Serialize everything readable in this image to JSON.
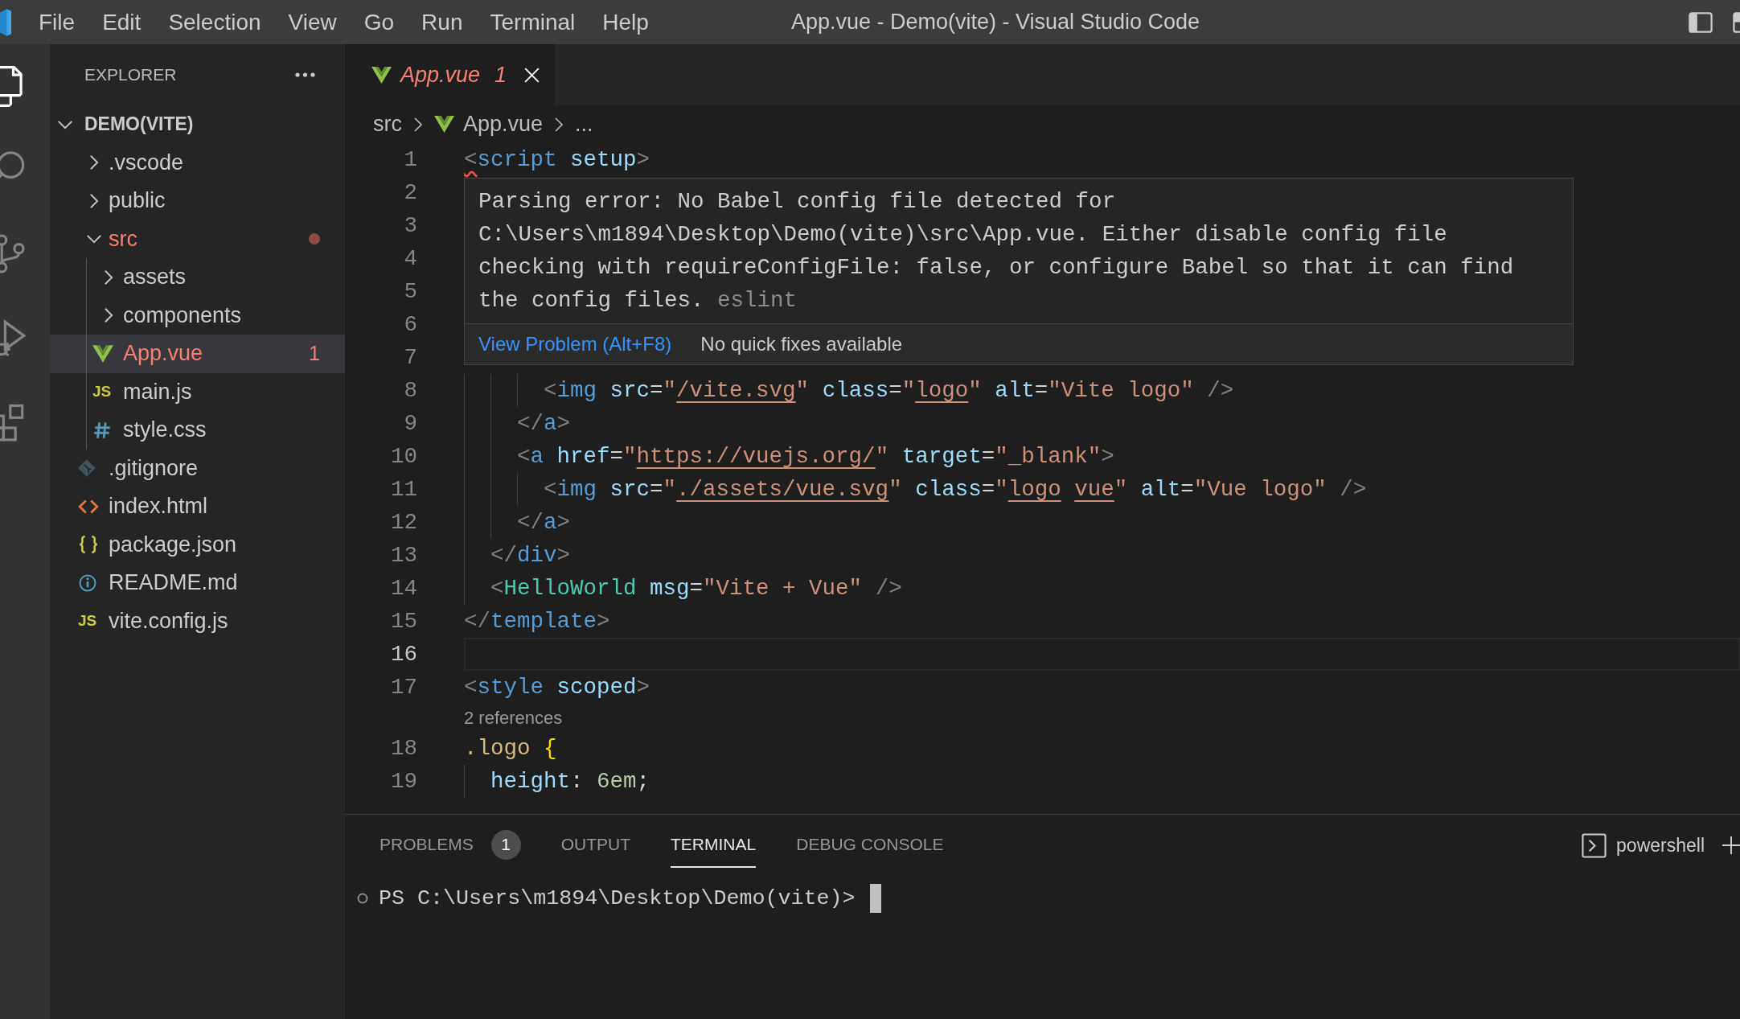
{
  "menu_bar": [
    "File",
    "Edit",
    "Selection",
    "View",
    "Go",
    "Run",
    "Terminal",
    "Help"
  ],
  "window": {
    "title": "App.vue - Demo(vite) - Visual Studio Code"
  },
  "activity_bar": [
    {
      "selected": true
    },
    {
      "selected": false
    },
    {
      "selected": false
    },
    {
      "selected": false
    },
    {
      "selected": false
    }
  ],
  "explorer": {
    "title": "EXPLORER",
    "root": {
      "label": "DEMO(VITE)",
      "expanded": true,
      "children": [
        {
          "label": ".vscode",
          "kind": "folder",
          "expanded": false,
          "selected": false,
          "error": false
        },
        {
          "label": "public",
          "kind": "folder",
          "expanded": false,
          "selected": false,
          "error": false
        },
        {
          "label": "src",
          "kind": "folder",
          "expanded": true,
          "selected": false,
          "error": true,
          "children": [
            {
              "label": "assets",
              "kind": "folder",
              "expanded": false,
              "selected": false,
              "error": false
            },
            {
              "label": "components",
              "kind": "folder",
              "expanded": false,
              "selected": false,
              "error": false
            },
            {
              "label": "App.vue",
              "kind": "vue",
              "selected": true,
              "error": true,
              "problems": "1"
            },
            {
              "label": "main.js",
              "kind": "js",
              "icon_text": "JS",
              "selected": false,
              "error": false
            },
            {
              "label": "style.css",
              "kind": "css",
              "selected": false,
              "error": false
            }
          ]
        },
        {
          "label": ".gitignore",
          "kind": "git",
          "selected": false,
          "error": false
        },
        {
          "label": "index.html",
          "kind": "html",
          "selected": false,
          "error": false
        },
        {
          "label": "package.json",
          "kind": "json",
          "selected": false,
          "error": false
        },
        {
          "label": "README.md",
          "kind": "info",
          "selected": false,
          "error": false
        },
        {
          "label": "vite.config.js",
          "kind": "js",
          "icon_text": "JS",
          "selected": false,
          "error": false
        }
      ]
    }
  },
  "editor": {
    "tabs": [
      {
        "label": "App.vue",
        "kind": "vue",
        "selected": true,
        "preview": true,
        "error": true,
        "problems": "1"
      }
    ],
    "breadcrumbs": [
      {
        "label": "src",
        "kind": "folder"
      },
      {
        "label": "App.vue",
        "kind": "vue"
      },
      {
        "label": "...",
        "kind": "symbol"
      }
    ],
    "lines": [
      {
        "kind": "code",
        "number": "1",
        "current": false,
        "tokens": [
          {
            "kind": "error",
            "text": "<"
          },
          {
            "kind": "tag",
            "text": "script"
          },
          {
            "kind": "attr",
            "text": " setup"
          },
          {
            "kind": "punct",
            "text": ">"
          }
        ]
      },
      {
        "kind": "code",
        "number": "2",
        "current": false
      },
      {
        "kind": "code",
        "number": "3",
        "current": false
      },
      {
        "kind": "code",
        "number": "4",
        "current": false
      },
      {
        "kind": "code",
        "number": "5",
        "current": false
      },
      {
        "kind": "code",
        "number": "6",
        "current": false
      },
      {
        "kind": "code",
        "number": "7",
        "current": false
      },
      {
        "kind": "code",
        "number": "8",
        "current": false,
        "tokens": [
          {
            "kind": "punct",
            "text": "      <"
          },
          {
            "kind": "tag",
            "text": "img"
          },
          {
            "kind": "attr",
            "text": " src"
          },
          {
            "kind": "op",
            "text": "="
          },
          {
            "kind": "string",
            "text": "\""
          },
          {
            "kind": "link",
            "text": "/vite.svg"
          },
          {
            "kind": "string",
            "text": "\""
          },
          {
            "kind": "attr",
            "text": " class"
          },
          {
            "kind": "op",
            "text": "="
          },
          {
            "kind": "string",
            "text": "\""
          },
          {
            "kind": "link",
            "text": "logo"
          },
          {
            "kind": "string",
            "text": "\""
          },
          {
            "kind": "attr",
            "text": " alt"
          },
          {
            "kind": "op",
            "text": "="
          },
          {
            "kind": "string",
            "text": "\"Vite logo\""
          },
          {
            "kind": "punct",
            "text": " />"
          }
        ]
      },
      {
        "kind": "code",
        "number": "9",
        "current": false,
        "tokens": [
          {
            "kind": "punct",
            "text": "    </"
          },
          {
            "kind": "tag",
            "text": "a"
          },
          {
            "kind": "punct",
            "text": ">"
          }
        ]
      },
      {
        "kind": "code",
        "number": "10",
        "current": false,
        "tokens": [
          {
            "kind": "punct",
            "text": "    <"
          },
          {
            "kind": "tag",
            "text": "a"
          },
          {
            "kind": "attr",
            "text": " href"
          },
          {
            "kind": "op",
            "text": "="
          },
          {
            "kind": "string",
            "text": "\""
          },
          {
            "kind": "link",
            "text": "https://vuejs.org/"
          },
          {
            "kind": "string",
            "text": "\""
          },
          {
            "kind": "attr",
            "text": " target"
          },
          {
            "kind": "op",
            "text": "="
          },
          {
            "kind": "string",
            "text": "\"_blank\""
          },
          {
            "kind": "punct",
            "text": ">"
          }
        ]
      },
      {
        "kind": "code",
        "number": "11",
        "current": false,
        "tokens": [
          {
            "kind": "punct",
            "text": "      <"
          },
          {
            "kind": "tag",
            "text": "img"
          },
          {
            "kind": "attr",
            "text": " src"
          },
          {
            "kind": "op",
            "text": "="
          },
          {
            "kind": "string",
            "text": "\""
          },
          {
            "kind": "link",
            "text": "./assets/vue.svg"
          },
          {
            "kind": "string",
            "text": "\""
          },
          {
            "kind": "attr",
            "text": " class"
          },
          {
            "kind": "op",
            "text": "="
          },
          {
            "kind": "string",
            "text": "\""
          },
          {
            "kind": "link",
            "text": "logo"
          },
          {
            "kind": "link",
            "text": " vue"
          },
          {
            "kind": "string",
            "text": "\""
          },
          {
            "kind": "attr",
            "text": " alt"
          },
          {
            "kind": "op",
            "text": "="
          },
          {
            "kind": "string",
            "text": "\"Vue logo\""
          },
          {
            "kind": "punct",
            "text": " />"
          }
        ]
      },
      {
        "kind": "code",
        "number": "12",
        "current": false,
        "tokens": [
          {
            "kind": "punct",
            "text": "    </"
          },
          {
            "kind": "tag",
            "text": "a"
          },
          {
            "kind": "punct",
            "text": ">"
          }
        ]
      },
      {
        "kind": "code",
        "number": "13",
        "current": false,
        "tokens": [
          {
            "kind": "punct",
            "text": "  </"
          },
          {
            "kind": "tag",
            "text": "div"
          },
          {
            "kind": "punct",
            "text": ">"
          }
        ]
      },
      {
        "kind": "code",
        "number": "14",
        "current": false,
        "tokens": [
          {
            "kind": "punct",
            "text": "  <"
          },
          {
            "kind": "component",
            "text": "HelloWorld"
          },
          {
            "kind": "attr",
            "text": " msg"
          },
          {
            "kind": "op",
            "text": "="
          },
          {
            "kind": "string",
            "text": "\"Vite + Vue\""
          },
          {
            "kind": "punct",
            "text": " />"
          }
        ]
      },
      {
        "kind": "code",
        "number": "15",
        "current": false,
        "tokens": [
          {
            "kind": "punct",
            "text": "</"
          },
          {
            "kind": "tag",
            "text": "template"
          },
          {
            "kind": "punct",
            "text": ">"
          }
        ]
      },
      {
        "kind": "code",
        "number": "16",
        "current": true
      },
      {
        "kind": "code",
        "number": "17",
        "current": false,
        "tokens": [
          {
            "kind": "punct",
            "text": "<"
          },
          {
            "kind": "tag",
            "text": "style"
          },
          {
            "kind": "attr",
            "text": " scoped"
          },
          {
            "kind": "punct",
            "text": ">"
          }
        ]
      },
      {
        "kind": "codelens",
        "text": "2 references"
      },
      {
        "kind": "code",
        "number": "18",
        "current": false,
        "tokens": [
          {
            "kind": "selector",
            "text": ".logo"
          },
          {
            "kind": "brace",
            "text": " {"
          }
        ]
      },
      {
        "kind": "code",
        "number": "19",
        "current": false,
        "tokens": [
          {
            "kind": "prop",
            "text": "  height"
          },
          {
            "kind": "op",
            "text": ":"
          },
          {
            "kind": "number",
            "text": " 6em"
          },
          {
            "kind": "op",
            "text": ";"
          }
        ]
      }
    ],
    "hover": {
      "message": "Parsing error: No Babel config file detected for C:\\Users\\m1894\\Desktop\\Demo(vite)\\src\\App.vue. Either disable config file checking with requireConfigFile: false, or configure Babel so that it can find the config files.",
      "source": "eslint",
      "actions": [
        {
          "label": "View Problem (Alt+F8)",
          "kind": "link"
        },
        {
          "label": "No quick fixes available",
          "kind": "note"
        }
      ]
    }
  },
  "panel": {
    "tabs": [
      {
        "label": "PROBLEMS",
        "badge": "1",
        "selected": false
      },
      {
        "label": "OUTPUT",
        "selected": false
      },
      {
        "label": "TERMINAL",
        "selected": true
      },
      {
        "label": "DEBUG CONSOLE",
        "selected": false
      }
    ],
    "shell": "powershell",
    "terminal": {
      "prompt": "PS C:\\Users\\m1894\\Desktop\\Demo(vite)>"
    }
  }
}
